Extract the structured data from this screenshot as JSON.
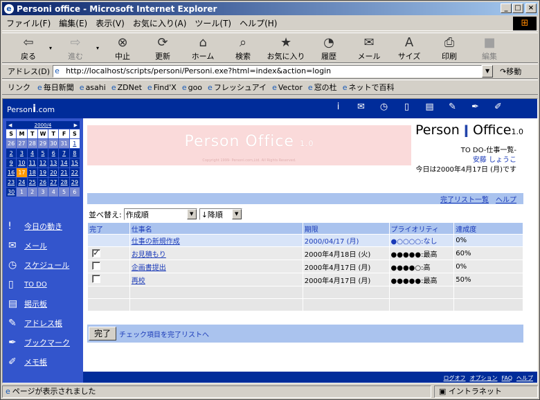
{
  "window": {
    "title": "Personi office - Microsoft Internet Explorer",
    "controls": [
      "_",
      "□",
      "×"
    ]
  },
  "menu": [
    "ファイル(F)",
    "編集(E)",
    "表示(V)",
    "お気に入り(A)",
    "ツール(T)",
    "ヘルプ(H)"
  ],
  "toolbar": [
    {
      "label": "戻る",
      "icon": "back-arrow-icon",
      "enabled": true
    },
    {
      "label": "進む",
      "icon": "forward-arrow-icon",
      "enabled": false
    },
    {
      "label": "中止",
      "icon": "stop-icon",
      "enabled": true
    },
    {
      "label": "更新",
      "icon": "refresh-icon",
      "enabled": true
    },
    {
      "label": "ホーム",
      "icon": "home-icon",
      "enabled": true
    },
    {
      "label": "検索",
      "icon": "search-icon",
      "enabled": true
    },
    {
      "label": "お気に入り",
      "icon": "favorites-icon",
      "enabled": true
    },
    {
      "label": "履歴",
      "icon": "history-icon",
      "enabled": true
    },
    {
      "label": "メール",
      "icon": "mail-icon",
      "enabled": true
    },
    {
      "label": "サイズ",
      "icon": "font-size-icon",
      "enabled": true
    },
    {
      "label": "印刷",
      "icon": "print-icon",
      "enabled": true
    },
    {
      "label": "編集",
      "icon": "edit-icon",
      "enabled": false
    }
  ],
  "address": {
    "label": "アドレス(D)",
    "url": "http://localhost/scripts/personi/Personi.exe?html=index&action=login",
    "go": "移動"
  },
  "links": {
    "label": "リンク",
    "items": [
      "毎日新聞",
      "asahi",
      "ZDNet",
      "Find'X",
      "goo",
      "フレッシュアイ",
      "Vector",
      "窓の杜",
      "ネットで百科"
    ]
  },
  "site": {
    "logo_text": "Person",
    "logo_suffix": ".com",
    "top_icons": [
      "i",
      "✉",
      "◷",
      "▯",
      "▤",
      "✎",
      "✒",
      "✐"
    ]
  },
  "calendar": {
    "month": "2000/4",
    "headers": [
      "S",
      "M",
      "T",
      "W",
      "T",
      "F",
      "S"
    ],
    "days": [
      [
        "26",
        "27",
        "28",
        "29",
        "30",
        "31",
        "1"
      ],
      [
        "2",
        "3",
        "4",
        "5",
        "6",
        "7",
        "8"
      ],
      [
        "9",
        "10",
        "11",
        "12",
        "13",
        "14",
        "15"
      ],
      [
        "16",
        "17",
        "18",
        "19",
        "20",
        "21",
        "22"
      ],
      [
        "23",
        "24",
        "25",
        "26",
        "27",
        "28",
        "29"
      ],
      [
        "30",
        "1",
        "2",
        "3",
        "4",
        "5",
        "6"
      ]
    ],
    "today": "17"
  },
  "nav": [
    {
      "label": "今日の動き",
      "icon": "person-icon"
    },
    {
      "label": "メール",
      "icon": "mail-icon"
    },
    {
      "label": "スケジュール",
      "icon": "clock-icon"
    },
    {
      "label": "TO DO",
      "icon": "todo-icon"
    },
    {
      "label": "掲示板",
      "icon": "board-icon"
    },
    {
      "label": "アドレス帳",
      "icon": "address-book-icon"
    },
    {
      "label": "ブックマーク",
      "icon": "bookmark-icon"
    },
    {
      "label": "メモ帳",
      "icon": "memo-icon"
    }
  ],
  "banner": {
    "text": "Person Office",
    "version": "1.0",
    "copy": "Copyright 1999- Personi.com,Ltd. All Rights Reserved."
  },
  "brand": {
    "name1": "Person",
    "name2": "Office",
    "version": "1.0"
  },
  "page": {
    "subtitle": "TO DO-仕事一覧-",
    "user": "安藤 しょうこ",
    "date": "今日は2000年4月17日 (月)です"
  },
  "links_right": [
    "完了リスト一覧",
    "ヘルプ"
  ],
  "sort": {
    "label": "並べ替え:",
    "by": "作成順",
    "order": "↓降順"
  },
  "table": {
    "headers": [
      "完了",
      "仕事名",
      "期限",
      "プライオリティ",
      "達成度"
    ],
    "new_task": {
      "name": "仕事の新規作成",
      "deadline": "2000/04/17 (月)",
      "priority": "●○○○○:なし",
      "progress": "0%"
    },
    "rows": [
      {
        "done": true,
        "name": "お見積もり",
        "deadline": "2000年4月18日 (火)",
        "priority": "●●●●●:最高",
        "progress": "60%"
      },
      {
        "done": false,
        "name": "企画書提出",
        "deadline": "2000年4月17日 (月)",
        "priority": "●●●●○:高",
        "progress": "0%"
      },
      {
        "done": false,
        "name": "再校",
        "deadline": "2000年4月17日 (月)",
        "priority": "●●●●●:最高",
        "progress": "50%"
      }
    ]
  },
  "footer": {
    "button": "完了",
    "text": "チェック項目を完了リストへ"
  },
  "bottom_links": [
    "ログオフ",
    "オプション",
    "FAQ",
    "ヘルプ"
  ],
  "status": {
    "text": "ページが表示されました",
    "zone": "イントラネット"
  }
}
